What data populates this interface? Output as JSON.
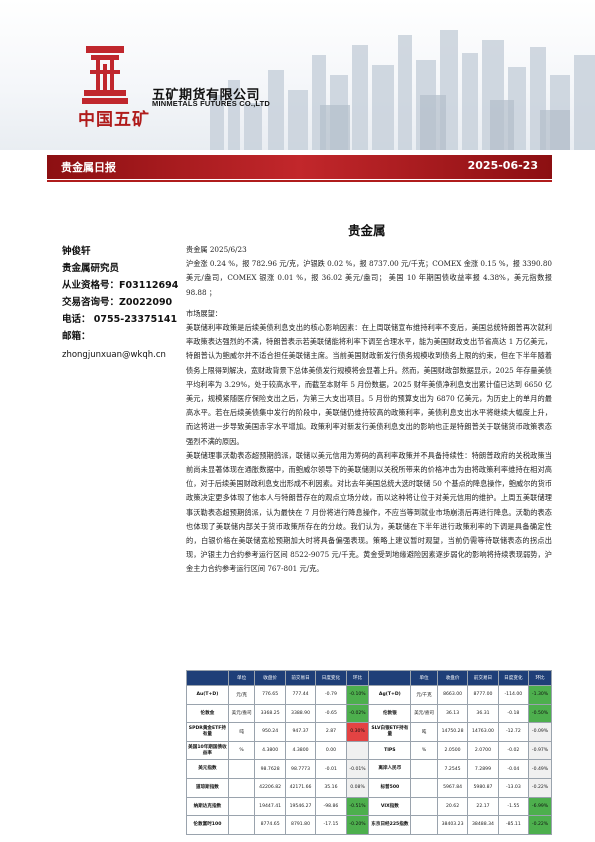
{
  "header": {
    "brand_cn": "中国五矿",
    "company_cn": "五矿期货有限公司",
    "company_en": "MINMETALS FUTURES CO.,LTD",
    "report_title": "贵金属日报",
    "report_date": "2025-06-23"
  },
  "main_title": "贵金属",
  "author": {
    "name": "钟俊轩",
    "role": "贵金属研究员",
    "license": "从业资格号：F03112694",
    "consult": "交易咨询号：Z0022090",
    "phone": "电话： 0755-23375141",
    "email_label": "邮箱：",
    "email": "zhongjunxuan@wkqh.cn"
  },
  "body": {
    "date_line": "贵金属 2025/6/23",
    "summary": "沪金涨 0.24 %，报 782.96 元/克，沪银跌 0.02 %，报 8737.00 元/千克；COMEX 金涨 0.15 %，报 3390.80 美元/盎司，COMEX 银涨 0.01 %，报 36.02 美元/盎司； 美国 10 年期国债收益率报 4.38%，美元指数报 98.88 ；",
    "outlook_title": "市场展望：",
    "para1": "美联储利率政策是后续美债利息支出的核心影响因素：在上周联储宣布维持利率不变后，美国总统特朗普再次就利率政策表达强烈的不满，特朗普表示若美联储能将利率下调至合理水平，能为美国财政支出节省高达 1 万亿美元，特朗普认为鲍威尔并不适合担任美联储主席。当前美国财政新发行债务规模收到债务上限的约束，但在下半年随着债务上限得到解决，宽财政背景下总体美债发行规模将会显著上升。然而，美国财政部数据显示，2025 年存量美债平均利率为 3.29%，处于较高水平，而截至本财年 5 月份数据，2025 财年美债净利息支出累计值已达到 6650 亿美元，规模紧随医疗保险支出之后，为第三大支出项目。5 月份的预算支出为 6870 亿美元，为历史上的单月的最高水平。若在后续美债集中发行的阶段中，美联储仍维持较高的政策利率，美债利息支出水平将继续大幅度上升，而这将进一步导致美国赤字水平增加。政策利率对新发行美债利息支出的影响也正是特朗普关于联储货币政策表态强烈不满的原因。",
    "para2": "美联储理事沃勒表态超预期鸽派，联储以美元信用为筹码的高利率政策并不具备持续性：特朗普政府的关税政策当前尚未显著体现在通胀数据中，而鲍威尔领导下的美联储则以关税所带来的价格冲击为由将政策利率维持在相对高位，对于后续美国财政利息支出形成不利因素。对比去年美国总统大选时联储 50 个基点的降息操作，鲍威尔的货币政策决定更多体现了他本人与特朗普存在的观点立场分歧，而以这种将让位于对美元信用的维护。上周五美联储理事沃勒表态超预期鸽派，认为最快在 7 月份将进行降息操作，不应当等到就业市场崩溃后再进行降息。沃勒的表态也体现了美联储内部关于货币政策所存在的分歧。我们认为，美联储在下半年进行政策利率的下调是具备确定性的，白银价格在美联储宽松预期加大时将具备偏强表现。策略上建议暂时观望，当前仍需等待联储表态的拐点出现，沪银主力合约参考运行区间 8522-9075 元/千克。黄金受到地缘避险因素逐步弱化的影响将持续表现弱势，沪金主力合约参考运行区间 767-801 元/克。"
  },
  "table": {
    "headers": [
      "",
      "单位",
      "收盘价",
      "前交易日",
      "日度变化",
      "环比",
      "",
      "单位",
      "收盘价",
      "前交易日",
      "日度变化",
      "环比"
    ],
    "rows": [
      {
        "n1": "Au(T+D)",
        "u1": "元/克",
        "c1": "776.65",
        "p1": "777.44",
        "d1": "-0.79",
        "r1": "-0.10%",
        "s1": "neg",
        "n2": "Ag(T+D)",
        "u2": "元/千克",
        "c2": "8663.00",
        "p2": "8777.00",
        "d2": "-114.00",
        "r2": "-1.30%",
        "s2": "neg"
      },
      {
        "n1": "伦敦金",
        "u1": "美元/盎司",
        "c1": "3368.25",
        "p1": "3388.90",
        "d1": "-0.65",
        "r1": "-0.02%",
        "s1": "neg",
        "n2": "伦敦银",
        "u2": "美元/盎司",
        "c2": "36.13",
        "p2": "36.31",
        "d2": "-0.18",
        "r2": "-0.50%",
        "s2": "neg"
      },
      {
        "n1": "SPDR黄金ETF持有量",
        "u1": "吨",
        "c1": "950.24",
        "p1": "947.37",
        "d1": "2.87",
        "r1": "0.30%",
        "s1": "pos",
        "n2": "SLV白银ETF持有量",
        "u2": "吨",
        "c2": "14750.28",
        "p2": "14763.00",
        "d2": "-12.72",
        "r2": "-0.09%",
        "s2": "mid"
      },
      {
        "n1": "美国10年期国债收益率",
        "u1": "%",
        "c1": "4.3800",
        "p1": "4.3800",
        "d1": "0.00",
        "r1": "",
        "s1": "mid",
        "n2": "TIPS",
        "u2": "%",
        "c2": "2.0500",
        "p2": "2.0700",
        "d2": "-0.02",
        "r2": "-0.97%",
        "s2": "mid"
      },
      {
        "n1": "美元指数",
        "u1": "",
        "c1": "98.7628",
        "p1": "98.7773",
        "d1": "-0.01",
        "r1": "-0.01%",
        "s1": "mid",
        "n2": "离岸人民币",
        "u2": "",
        "c2": "7.2545",
        "p2": "7.2899",
        "d2": "-0.04",
        "r2": "-0.49%",
        "s2": "mid"
      },
      {
        "n1": "道琼斯指数",
        "u1": "",
        "c1": "42206.82",
        "p1": "42171.66",
        "d1": "35.16",
        "r1": "0.08%",
        "s1": "mid",
        "n2": "标普500",
        "u2": "",
        "c2": "5967.84",
        "p2": "5980.87",
        "d2": "-13.03",
        "r2": "-0.22%",
        "s2": "mid"
      },
      {
        "n1": "纳斯达克指数",
        "u1": "",
        "c1": "19447.41",
        "p1": "19546.27",
        "d1": "-98.86",
        "r1": "-0.51%",
        "s1": "neg",
        "n2": "VIX指数",
        "u2": "",
        "c2": "20.62",
        "p2": "22.17",
        "d2": "-1.55",
        "r2": "-6.99%",
        "s2": "neg"
      },
      {
        "n1": "伦敦富时100",
        "u1": "",
        "c1": "8774.65",
        "p1": "8791.80",
        "d1": "-17.15",
        "r1": "-0.20%",
        "s1": "neg",
        "n2": "东京日经225指数",
        "u2": "",
        "c2": "38403.23",
        "p2": "38488.34",
        "d2": "-85.11",
        "r2": "-0.22%",
        "s2": "neg"
      }
    ]
  },
  "colors": {
    "brand_red": "#b01c1c",
    "header_blue": "#1f3f78",
    "up_red": "#e34343",
    "down_green": "#4daf4d"
  }
}
